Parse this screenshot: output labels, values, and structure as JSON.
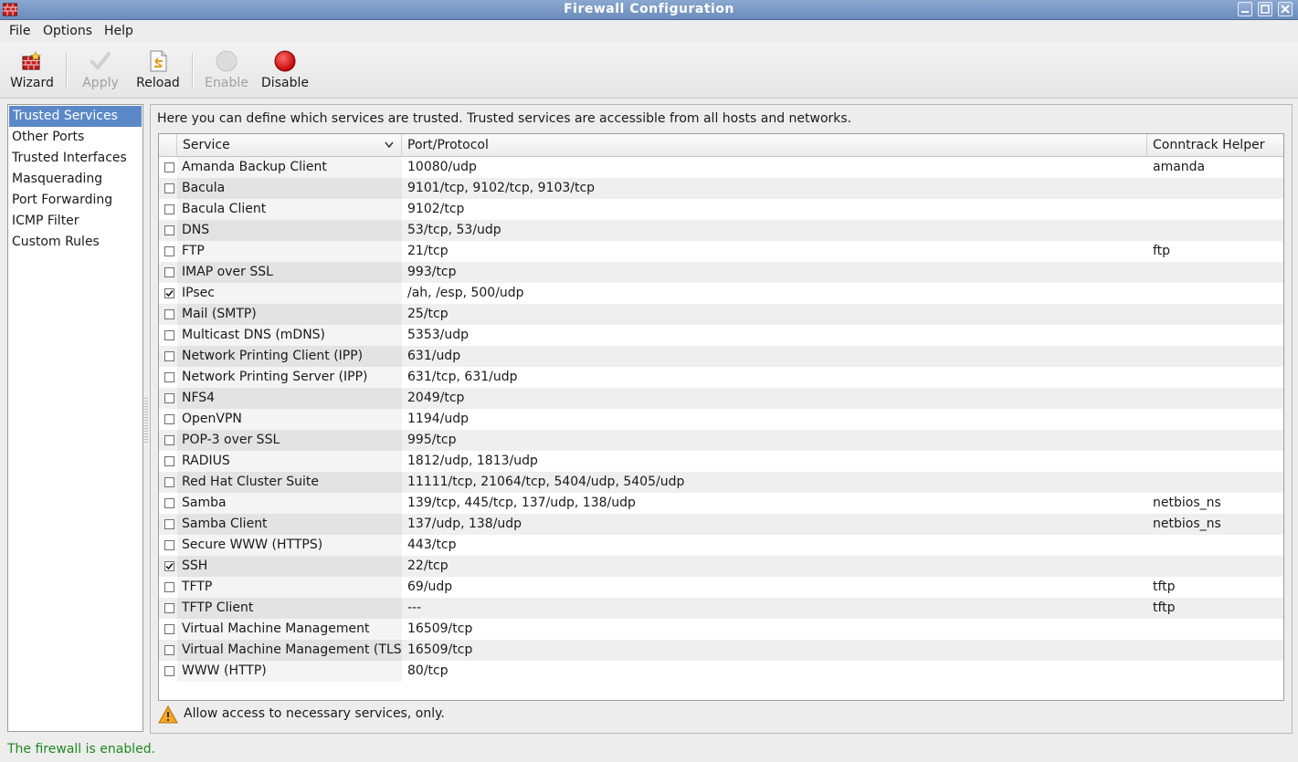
{
  "window": {
    "title": "Firewall Configuration"
  },
  "menu": [
    "File",
    "Options",
    "Help"
  ],
  "toolbar": {
    "wizard": "Wizard",
    "apply": "Apply",
    "reload": "Reload",
    "enable": "Enable",
    "disable": "Disable"
  },
  "sidebar": {
    "items": [
      "Trusted Services",
      "Other Ports",
      "Trusted Interfaces",
      "Masquerading",
      "Port Forwarding",
      "ICMP Filter",
      "Custom Rules"
    ],
    "selected": "Trusted Services"
  },
  "main": {
    "intro": "Here you can define which services are trusted. Trusted services are accessible from all hosts and networks.",
    "columns": {
      "service": "Service",
      "port": "Port/Protocol",
      "helper": "Conntrack Helper"
    },
    "rows": [
      {
        "checked": false,
        "service": "Amanda Backup Client",
        "port": "10080/udp",
        "helper": "amanda"
      },
      {
        "checked": false,
        "service": "Bacula",
        "port": "9101/tcp, 9102/tcp, 9103/tcp",
        "helper": ""
      },
      {
        "checked": false,
        "service": "Bacula Client",
        "port": "9102/tcp",
        "helper": ""
      },
      {
        "checked": false,
        "service": "DNS",
        "port": "53/tcp, 53/udp",
        "helper": ""
      },
      {
        "checked": false,
        "service": "FTP",
        "port": "21/tcp",
        "helper": "ftp"
      },
      {
        "checked": false,
        "service": "IMAP over SSL",
        "port": "993/tcp",
        "helper": ""
      },
      {
        "checked": true,
        "service": "IPsec",
        "port": "/ah, /esp, 500/udp",
        "helper": ""
      },
      {
        "checked": false,
        "service": "Mail (SMTP)",
        "port": "25/tcp",
        "helper": ""
      },
      {
        "checked": false,
        "service": "Multicast DNS (mDNS)",
        "port": "5353/udp",
        "helper": ""
      },
      {
        "checked": false,
        "service": "Network Printing Client (IPP)",
        "port": "631/udp",
        "helper": ""
      },
      {
        "checked": false,
        "service": "Network Printing Server (IPP)",
        "port": "631/tcp, 631/udp",
        "helper": ""
      },
      {
        "checked": false,
        "service": "NFS4",
        "port": "2049/tcp",
        "helper": ""
      },
      {
        "checked": false,
        "service": "OpenVPN",
        "port": "1194/udp",
        "helper": ""
      },
      {
        "checked": false,
        "service": "POP-3 over SSL",
        "port": "995/tcp",
        "helper": ""
      },
      {
        "checked": false,
        "service": "RADIUS",
        "port": "1812/udp, 1813/udp",
        "helper": ""
      },
      {
        "checked": false,
        "service": "Red Hat Cluster Suite",
        "port": "11111/tcp, 21064/tcp, 5404/udp, 5405/udp",
        "helper": ""
      },
      {
        "checked": false,
        "service": "Samba",
        "port": "139/tcp, 445/tcp, 137/udp, 138/udp",
        "helper": "netbios_ns"
      },
      {
        "checked": false,
        "service": "Samba Client",
        "port": "137/udp, 138/udp",
        "helper": "netbios_ns"
      },
      {
        "checked": false,
        "service": "Secure WWW (HTTPS)",
        "port": "443/tcp",
        "helper": ""
      },
      {
        "checked": true,
        "service": "SSH",
        "port": "22/tcp",
        "helper": ""
      },
      {
        "checked": false,
        "service": "TFTP",
        "port": "69/udp",
        "helper": "tftp"
      },
      {
        "checked": false,
        "service": "TFTP Client",
        "port": "---",
        "helper": "tftp"
      },
      {
        "checked": false,
        "service": "Virtual Machine Management",
        "port": "16509/tcp",
        "helper": ""
      },
      {
        "checked": false,
        "service": "Virtual Machine Management (TLS)",
        "port": "16509/tcp",
        "helper": ""
      },
      {
        "checked": false,
        "service": "WWW (HTTP)",
        "port": "80/tcp",
        "helper": ""
      }
    ],
    "note": "Allow access to necessary services, only."
  },
  "status": {
    "text": "The firewall is enabled.",
    "color": "#1e8a1e"
  },
  "icons": {
    "wizard": "firewall-wizard-icon",
    "apply": "checkmark-icon",
    "reload": "reload-icon",
    "enable": "grey-circle-icon",
    "disable": "red-circle-icon",
    "warning": "warning-icon"
  }
}
